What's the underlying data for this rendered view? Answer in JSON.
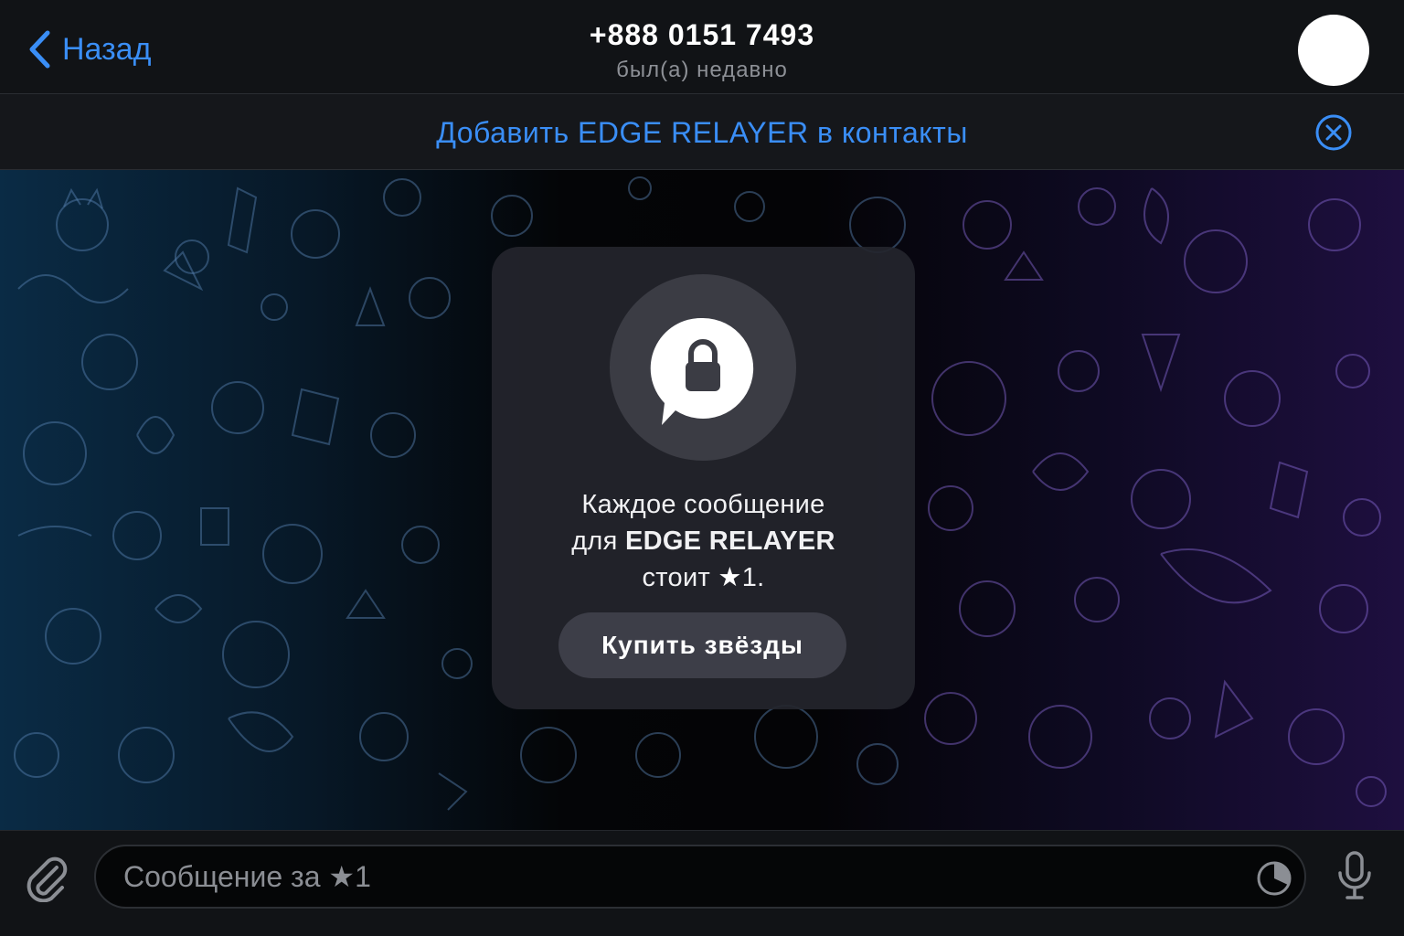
{
  "header": {
    "back_label": "Назад",
    "title": "+888 0151 7493",
    "status": "был(а) недавно"
  },
  "add_contact_bar": {
    "label": "Добавить EDGE RELAYER в контакты"
  },
  "paywall": {
    "line1": "Каждое сообщение",
    "line2_prefix": "для ",
    "line2_name": "EDGE RELAYER",
    "line3_prefix": "стоит ",
    "line3_star": "★",
    "line3_price": "1.",
    "buy_button": "Купить звёзды"
  },
  "composer": {
    "placeholder_text": "Сообщение за ",
    "placeholder_star": "★",
    "placeholder_price": "1"
  },
  "colors": {
    "accent": "#3a8ef6",
    "background": "#111316"
  },
  "icons": {
    "back": "chevron-left-icon",
    "close": "close-circle-icon",
    "lock": "lock-chat-bubble-icon",
    "attach": "paperclip-icon",
    "timer": "timer-icon",
    "mic": "microphone-icon"
  }
}
